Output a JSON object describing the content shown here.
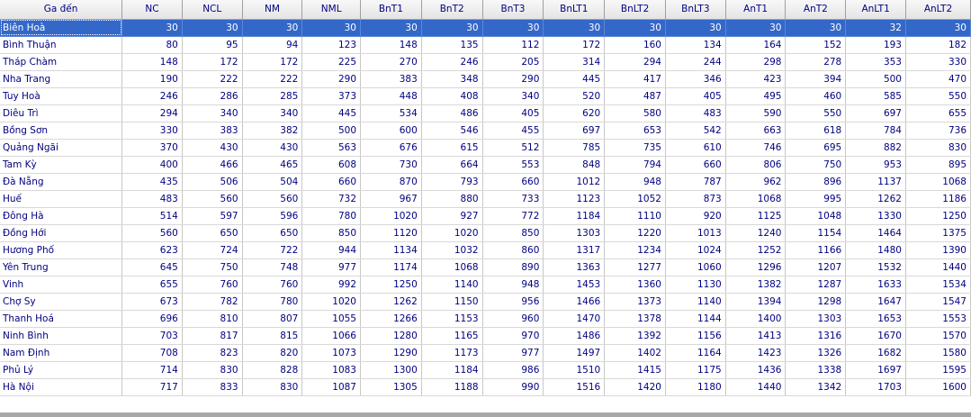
{
  "columns": [
    "Ga đến",
    "NC",
    "NCL",
    "NM",
    "NML",
    "BnT1",
    "BnT2",
    "BnT3",
    "BnLT1",
    "BnLT2",
    "BnLT3",
    "AnT1",
    "AnT2",
    "AnLT1",
    "AnLT2"
  ],
  "selected_row": 0,
  "rows": [
    {
      "station": "Biên Hoà",
      "values": [
        "30",
        "30",
        "30",
        "30",
        "30",
        "30",
        "30",
        "30",
        "30",
        "30",
        "30",
        "30",
        "32",
        "30"
      ]
    },
    {
      "station": "Bình Thuận",
      "values": [
        "80",
        "95",
        "94",
        "123",
        "148",
        "135",
        "112",
        "172",
        "160",
        "134",
        "164",
        "152",
        "193",
        "182"
      ]
    },
    {
      "station": "Tháp Chàm",
      "values": [
        "148",
        "172",
        "172",
        "225",
        "270",
        "246",
        "205",
        "314",
        "294",
        "244",
        "298",
        "278",
        "353",
        "330"
      ]
    },
    {
      "station": "Nha Trang",
      "values": [
        "190",
        "222",
        "222",
        "290",
        "383",
        "348",
        "290",
        "445",
        "417",
        "346",
        "423",
        "394",
        "500",
        "470"
      ]
    },
    {
      "station": "Tuy Hoà",
      "values": [
        "246",
        "286",
        "285",
        "373",
        "448",
        "408",
        "340",
        "520",
        "487",
        "405",
        "495",
        "460",
        "585",
        "550"
      ]
    },
    {
      "station": "Diêu Trì",
      "values": [
        "294",
        "340",
        "340",
        "445",
        "534",
        "486",
        "405",
        "620",
        "580",
        "483",
        "590",
        "550",
        "697",
        "655"
      ]
    },
    {
      "station": "Bồng Sơn",
      "values": [
        "330",
        "383",
        "382",
        "500",
        "600",
        "546",
        "455",
        "697",
        "653",
        "542",
        "663",
        "618",
        "784",
        "736"
      ]
    },
    {
      "station": "Quảng Ngãi",
      "values": [
        "370",
        "430",
        "430",
        "563",
        "676",
        "615",
        "512",
        "785",
        "735",
        "610",
        "746",
        "695",
        "882",
        "830"
      ]
    },
    {
      "station": "Tam Kỳ",
      "values": [
        "400",
        "466",
        "465",
        "608",
        "730",
        "664",
        "553",
        "848",
        "794",
        "660",
        "806",
        "750",
        "953",
        "895"
      ]
    },
    {
      "station": "Đà Nẵng",
      "values": [
        "435",
        "506",
        "504",
        "660",
        "870",
        "793",
        "660",
        "1012",
        "948",
        "787",
        "962",
        "896",
        "1137",
        "1068"
      ]
    },
    {
      "station": "Huế",
      "values": [
        "483",
        "560",
        "560",
        "732",
        "967",
        "880",
        "733",
        "1123",
        "1052",
        "873",
        "1068",
        "995",
        "1262",
        "1186"
      ]
    },
    {
      "station": "Đông Hà",
      "values": [
        "514",
        "597",
        "596",
        "780",
        "1020",
        "927",
        "772",
        "1184",
        "1110",
        "920",
        "1125",
        "1048",
        "1330",
        "1250"
      ]
    },
    {
      "station": "Đồng Hới",
      "values": [
        "560",
        "650",
        "650",
        "850",
        "1120",
        "1020",
        "850",
        "1303",
        "1220",
        "1013",
        "1240",
        "1154",
        "1464",
        "1375"
      ]
    },
    {
      "station": "Hương Phố",
      "values": [
        "623",
        "724",
        "722",
        "944",
        "1134",
        "1032",
        "860",
        "1317",
        "1234",
        "1024",
        "1252",
        "1166",
        "1480",
        "1390"
      ]
    },
    {
      "station": "Yên Trung",
      "values": [
        "645",
        "750",
        "748",
        "977",
        "1174",
        "1068",
        "890",
        "1363",
        "1277",
        "1060",
        "1296",
        "1207",
        "1532",
        "1440"
      ]
    },
    {
      "station": "Vinh",
      "values": [
        "655",
        "760",
        "760",
        "992",
        "1250",
        "1140",
        "948",
        "1453",
        "1360",
        "1130",
        "1382",
        "1287",
        "1633",
        "1534"
      ]
    },
    {
      "station": "Chợ Sy",
      "values": [
        "673",
        "782",
        "780",
        "1020",
        "1262",
        "1150",
        "956",
        "1466",
        "1373",
        "1140",
        "1394",
        "1298",
        "1647",
        "1547"
      ]
    },
    {
      "station": "Thanh Hoá",
      "values": [
        "696",
        "810",
        "807",
        "1055",
        "1266",
        "1153",
        "960",
        "1470",
        "1378",
        "1144",
        "1400",
        "1303",
        "1653",
        "1553"
      ]
    },
    {
      "station": "Ninh Bình",
      "values": [
        "703",
        "817",
        "815",
        "1066",
        "1280",
        "1165",
        "970",
        "1486",
        "1392",
        "1156",
        "1413",
        "1316",
        "1670",
        "1570"
      ]
    },
    {
      "station": "Nam Định",
      "values": [
        "708",
        "823",
        "820",
        "1073",
        "1290",
        "1173",
        "977",
        "1497",
        "1402",
        "1164",
        "1423",
        "1326",
        "1682",
        "1580"
      ]
    },
    {
      "station": "Phủ Lý",
      "values": [
        "714",
        "830",
        "828",
        "1083",
        "1300",
        "1184",
        "986",
        "1510",
        "1415",
        "1175",
        "1436",
        "1338",
        "1697",
        "1595"
      ]
    },
    {
      "station": "Hà Nội",
      "values": [
        "717",
        "833",
        "830",
        "1087",
        "1305",
        "1188",
        "990",
        "1516",
        "1420",
        "1180",
        "1440",
        "1342",
        "1703",
        "1600"
      ]
    }
  ]
}
